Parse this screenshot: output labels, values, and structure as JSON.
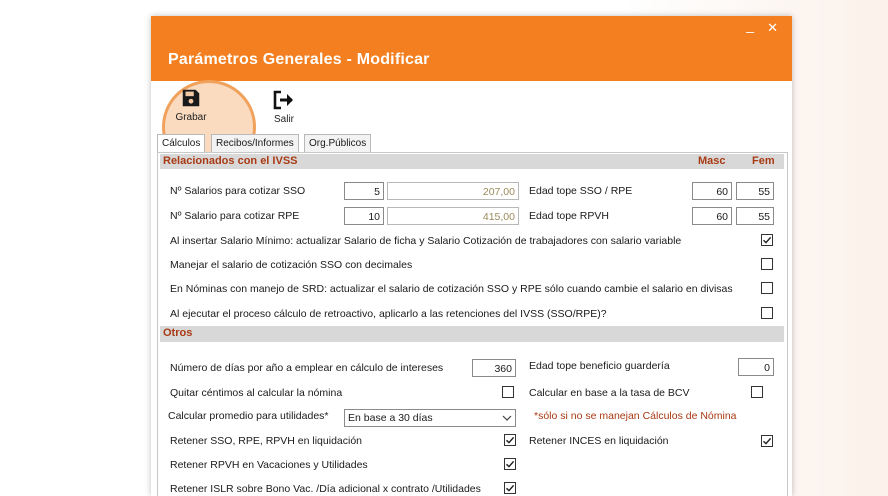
{
  "window": {
    "title": "Parámetros Generales - Modificar",
    "minimize_label": "_",
    "close_label": "✕"
  },
  "toolbar": {
    "grabar_label": "Grabar",
    "salir_label": "Salir"
  },
  "tabs": [
    {
      "label": "Cálculos",
      "active": true
    },
    {
      "label": "Recibos/Informes",
      "active": false
    },
    {
      "label": "Org.Públicos",
      "active": false
    }
  ],
  "ivss": {
    "header": "Relacionados con el IVSS",
    "masc_header": "Masc",
    "fem_header": "Fem",
    "salarios_sso_label": "Nº Salarios para cotizar SSO",
    "salarios_sso_value": "5",
    "salarios_sso_amount": "207,00",
    "salario_rpe_label": "Nº Salario para cotizar RPE",
    "salario_rpe_value": "10",
    "salario_rpe_amount": "415,00",
    "edad_sso_rpe_label": "Edad tope SSO / RPE",
    "edad_sso_rpe_masc": "60",
    "edad_sso_rpe_fem": "55",
    "edad_rpvh_label": "Edad tope RPVH",
    "edad_rpvh_masc": "60",
    "edad_rpvh_fem": "55",
    "opt_salario_minimo": "Al insertar Salario Mínimo: actualizar Salario de ficha y Salario Cotización de trabajadores con  salario variable",
    "opt_decimales": "Manejar el salario de cotización SSO con decimales",
    "opt_srd": "En Nóminas con manejo de SRD: actualizar el salario de cotización SSO y RPE sólo cuando cambie el salario en divisas",
    "opt_retroactivo": "Al ejecutar el proceso cálculo de retroactivo, aplicarlo a las retenciones del IVSS (SSO/RPE)?"
  },
  "otros": {
    "header": "Otros",
    "dias_label": "Número de días por año a emplear en cálculo de intereses",
    "dias_value": "360",
    "guarderia_label": "Edad tope beneficio guardería",
    "guarderia_value": "0",
    "centimos_label": "Quitar céntimos al calcular la nómina",
    "bcv_label": "Calcular en base a la tasa de BCV",
    "promedio_label": "Calcular promedio para utilidades*",
    "promedio_selected": "En base a 30 días",
    "promedio_note": "*sólo si no se manejan Cálculos de Nómina",
    "retener_liquidacion_label": "Retener SSO, RPE, RPVH en liquidación",
    "retener_inces_label": "Retener INCES en liquidación",
    "retener_rpvh_label": "Retener RPVH en Vacaciones y Utilidades",
    "retener_islr_label": "Retener ISLR sobre Bono Vac. /Día  adicional  x contrato /Utilidades"
  },
  "checkboxes": {
    "salario_minimo": true,
    "decimales": false,
    "srd": false,
    "retroactivo": false,
    "centimos": false,
    "bcv": false,
    "retener_liquidacion": true,
    "retener_inces": true,
    "retener_rpvh": true,
    "retener_islr": true
  },
  "colors": {
    "accent": "#f47f20",
    "section_text": "#a83a14"
  },
  "icons": {
    "save": "floppy-disk-icon",
    "exit": "exit-arrow-icon"
  }
}
